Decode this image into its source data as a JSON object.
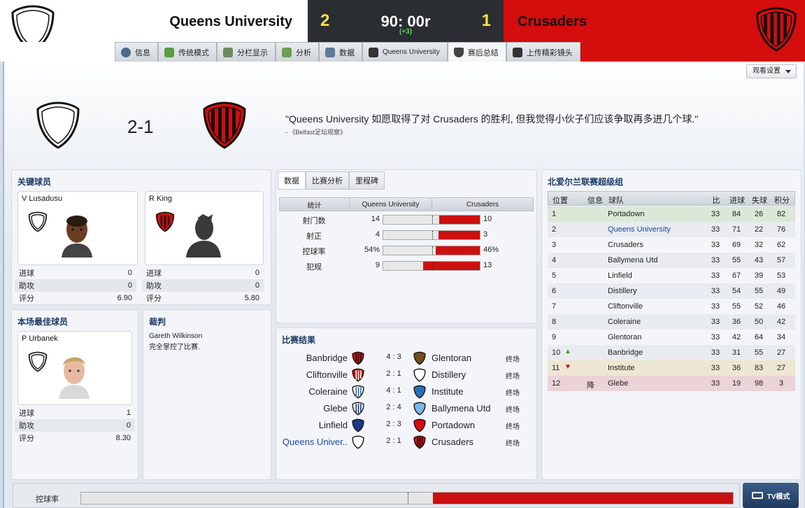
{
  "header": {
    "home_team": "Queens University",
    "away_team": "Crusaders",
    "home_score": "2",
    "away_score": "1",
    "match_time": "90: 00r",
    "added_time": "(+3)",
    "home_color": "#ffffff",
    "away_color": "#d40d0d"
  },
  "tabs": [
    {
      "label": "信息",
      "icon": "info-icon"
    },
    {
      "label": "传统模式",
      "icon": "pitch-icon"
    },
    {
      "label": "分栏显示",
      "icon": "split-view-icon"
    },
    {
      "label": "分析",
      "icon": "analysis-icon"
    },
    {
      "label": "数据",
      "icon": "stats-icon"
    },
    {
      "label": "Queens University",
      "icon": "team-icon"
    },
    {
      "label": "赛后总结",
      "icon": "shield-icon"
    },
    {
      "label": "上传精彩镜头",
      "icon": "camera-icon"
    }
  ],
  "view_settings": "观看设置",
  "summary": {
    "score": "2-1",
    "quote": "\"Queens University 如愿取得了对 Crusaders 的胜利, 但我觉得小伙子们应该争取再多进几个球.\"",
    "source": "- 《Belfast足坛观察》"
  },
  "key_players": {
    "title": "关键球员",
    "players": [
      {
        "name": "V Lusadusu",
        "stats": [
          [
            "进球",
            "0"
          ],
          [
            "助攻",
            "0"
          ],
          [
            "评分",
            "6.90"
          ]
        ]
      },
      {
        "name": "R King",
        "stats": [
          [
            "进球",
            "0"
          ],
          [
            "助攻",
            "0"
          ],
          [
            "评分",
            "5.80"
          ]
        ]
      }
    ]
  },
  "motm": {
    "title": "本场最佳球员",
    "name": "P Urbanek",
    "stats": [
      [
        "进球",
        "1"
      ],
      [
        "助攻",
        "0"
      ],
      [
        "评分",
        "8.30"
      ]
    ]
  },
  "referee": {
    "title": "裁判",
    "name": "Gareth Wilkinson",
    "note": "完全掌控了比赛."
  },
  "stats": {
    "tabs": [
      "数据",
      "比赛分析",
      "里程碑"
    ],
    "headers": [
      "统计",
      "Queens University",
      "Crusaders"
    ],
    "rows": [
      {
        "label": "射门数",
        "home": "14",
        "away": "10",
        "home_frac": 0.58,
        "away_frac": 0.42
      },
      {
        "label": "射正",
        "home": "4",
        "away": "3",
        "home_frac": 0.57,
        "away_frac": 0.43
      },
      {
        "label": "控球率",
        "home": "54%",
        "away": "46%",
        "home_frac": 0.54,
        "away_frac": 0.46
      },
      {
        "label": "犯规",
        "home": "9",
        "away": "13",
        "home_frac": 0.41,
        "away_frac": 0.59
      }
    ]
  },
  "results": {
    "title": "比赛结果",
    "matches": [
      {
        "home": "Banbridge",
        "score": "4 : 3",
        "away": "Glentoran",
        "status": "终场"
      },
      {
        "home": "Cliftonville",
        "score": "2 : 1",
        "away": "Distillery",
        "status": "终场"
      },
      {
        "home": "Coleraine",
        "score": "4 : 1",
        "away": "Institute",
        "status": "终场"
      },
      {
        "home": "Glebe",
        "score": "2 : 4",
        "away": "Ballymena Utd",
        "status": "终场"
      },
      {
        "home": "Linfield",
        "score": "2 : 3",
        "away": "Portadown",
        "status": "终场"
      },
      {
        "home": "Queens Univer..",
        "score": "2 : 1",
        "away": "Crusaders",
        "status": "终场"
      }
    ]
  },
  "league": {
    "title": "北爱尔兰联赛超级组",
    "headers": [
      "位置",
      "信息",
      "球队",
      "比赛",
      "进球",
      "失球",
      "积分"
    ],
    "rows": [
      {
        "pos": "1",
        "info": "",
        "team": "Portadown",
        "p": "33",
        "w": "84",
        "l": "26",
        "pts": "82"
      },
      {
        "pos": "2",
        "info": "",
        "team": "Queens University",
        "p": "33",
        "w": "71",
        "l": "22",
        "pts": "76"
      },
      {
        "pos": "3",
        "info": "",
        "team": "Crusaders",
        "p": "33",
        "w": "69",
        "l": "32",
        "pts": "62"
      },
      {
        "pos": "4",
        "info": "",
        "team": "Ballymena Utd",
        "p": "33",
        "w": "55",
        "l": "43",
        "pts": "57"
      },
      {
        "pos": "5",
        "info": "",
        "team": "Linfield",
        "p": "33",
        "w": "67",
        "l": "39",
        "pts": "53"
      },
      {
        "pos": "6",
        "info": "",
        "team": "Distillery",
        "p": "33",
        "w": "54",
        "l": "55",
        "pts": "49"
      },
      {
        "pos": "7",
        "info": "",
        "team": "Cliftonville",
        "p": "33",
        "w": "55",
        "l": "52",
        "pts": "46"
      },
      {
        "pos": "8",
        "info": "",
        "team": "Coleraine",
        "p": "33",
        "w": "36",
        "l": "50",
        "pts": "42"
      },
      {
        "pos": "9",
        "info": "",
        "team": "Glentoran",
        "p": "33",
        "w": "42",
        "l": "64",
        "pts": "34"
      },
      {
        "pos": "10",
        "info": "",
        "team": "Banbridge",
        "p": "33",
        "w": "31",
        "l": "55",
        "pts": "27"
      },
      {
        "pos": "11",
        "info": "",
        "team": "Institute",
        "p": "33",
        "w": "36",
        "l": "83",
        "pts": "27"
      },
      {
        "pos": "12",
        "info": "降",
        "team": "Glebe",
        "p": "33",
        "w": "19",
        "l": "98",
        "pts": "3"
      }
    ]
  },
  "bottom": {
    "possession_label": "控球率",
    "possession_home_frac": 0.54,
    "tv_label": "TV模式"
  }
}
